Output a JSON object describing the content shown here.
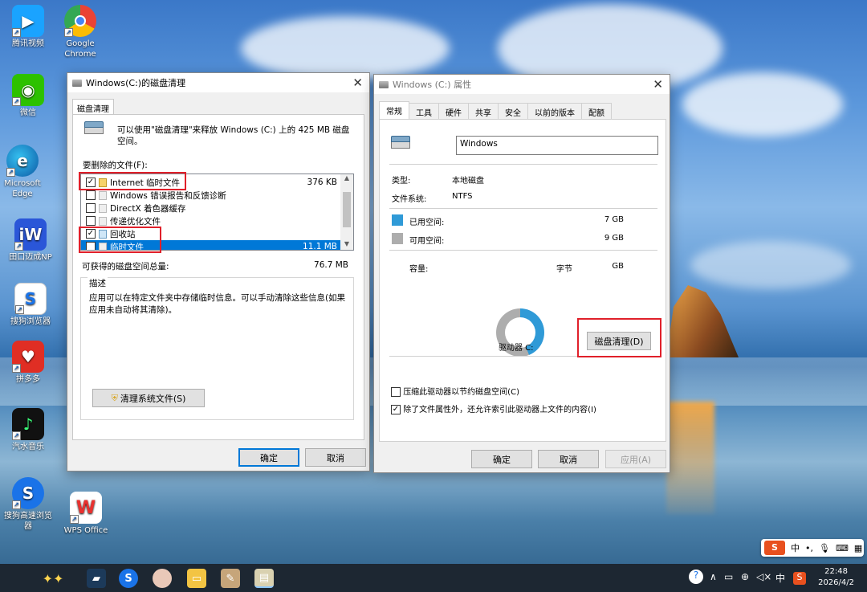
{
  "desktop": {
    "icons": [
      {
        "label": "腾讯视频",
        "color": "#1aa3ff",
        "icon": "tencent-video-icon"
      },
      {
        "label": "Google Chrome",
        "color": "#ffffff",
        "icon": "chrome-icon"
      },
      {
        "label": "微信",
        "color": "#2dc100",
        "icon": "wechat-icon"
      },
      {
        "label": "Microsoft Edge",
        "color": "#0c7bd4",
        "icon": "edge-icon"
      },
      {
        "label": "田口迈成NP",
        "color": "#2a56d8",
        "icon": "app-icon"
      },
      {
        "label": "搜狗浏览器",
        "color": "#ffffff",
        "icon": "sogou-browser-icon"
      },
      {
        "label": "拼多多",
        "color": "#e02e24",
        "icon": "pinduoduo-icon"
      },
      {
        "label": "汽水音乐",
        "color": "#111111",
        "icon": "music-icon"
      },
      {
        "label": "搜狗高速浏览器",
        "color": "#1a73e8",
        "icon": "sogou-icon"
      },
      {
        "label": "WPS Office",
        "color": "#ffffff",
        "icon": "wps-icon"
      }
    ]
  },
  "cleanup": {
    "title": "Windows(C:)的磁盘清理",
    "tab": "磁盘清理",
    "intro": "可以使用\"磁盘清理\"来释放 Windows (C:) 上的 425 MB 磁盘空间。",
    "files_label": "要删除的文件(F):",
    "files": [
      {
        "name": "Internet 临时文件",
        "size": "376 KB",
        "checked": "✓"
      },
      {
        "name": "Windows 错误报告和反馈诊断",
        "size": "",
        "checked": ""
      },
      {
        "name": "DirectX 着色器缓存",
        "size": "",
        "checked": ""
      },
      {
        "name": "传递优化文件",
        "size": "",
        "checked": ""
      },
      {
        "name": "回收站",
        "size": "",
        "checked": "✓"
      },
      {
        "name": "临时文件",
        "size": "11.1 MB",
        "checked": "✓"
      }
    ],
    "total_label": "可获得的磁盘空间总量:",
    "total_value": "76.7 MB",
    "desc_label": "描述",
    "desc_text": "应用可以在特定文件夹中存储临时信息。可以手动清除这些信息(如果应用未自动将其清除)。",
    "clean_system_btn": "清理系统文件(S)",
    "ok": "确定",
    "cancel": "取消"
  },
  "props": {
    "title": "Windows (C:) 属性",
    "tabs": [
      "常规",
      "工具",
      "硬件",
      "共享",
      "安全",
      "以前的版本",
      "配额"
    ],
    "name": "Windows",
    "type_label": "类型:",
    "type_value": "本地磁盘",
    "fs_label": "文件系统:",
    "fs_value": "NTFS",
    "used_label": "已用空间:",
    "used_value": "7 GB",
    "used_color": "#2f9ad7",
    "free_label": "可用空间:",
    "free_value": "9 GB",
    "free_color": "#adadad",
    "cap_label": "容量:",
    "cap_bytes": "字节",
    "cap_gb": "GB",
    "drive_label": "驱动器 C:",
    "cleanup_btn": "磁盘清理(D)",
    "compress": "压缩此驱动器以节约磁盘空间(C)",
    "index": "除了文件属性外，还允许索引此驱动器上文件的内容(I)",
    "index_checked": "✓",
    "ok": "确定",
    "cancel": "取消",
    "apply": "应用(A)"
  },
  "ime": {
    "logo": "S",
    "mode": "中",
    "punct": "•,"
  },
  "tray": {
    "lang": "中",
    "time": "22:48",
    "date": "2026/4/2"
  }
}
